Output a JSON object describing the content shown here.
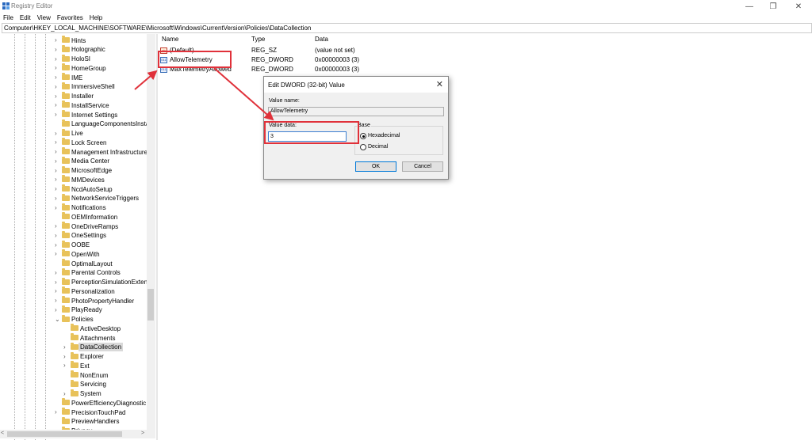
{
  "window": {
    "title": "Registry Editor",
    "controls": {
      "minimize": "—",
      "maximize": "❐",
      "close": "✕"
    }
  },
  "menu": [
    "File",
    "Edit",
    "View",
    "Favorites",
    "Help"
  ],
  "address": "Computer\\HKEY_LOCAL_MACHINE\\SOFTWARE\\Microsoft\\Windows\\CurrentVersion\\Policies\\DataCollection",
  "tree": [
    {
      "label": "Hints",
      "expander": ">",
      "level": 0
    },
    {
      "label": "Holographic",
      "expander": ">",
      "level": 0
    },
    {
      "label": "HoloSI",
      "expander": ">",
      "level": 0
    },
    {
      "label": "HomeGroup",
      "expander": ">",
      "level": 0
    },
    {
      "label": "IME",
      "expander": ">",
      "level": 0
    },
    {
      "label": "ImmersiveShell",
      "expander": ">",
      "level": 0
    },
    {
      "label": "Installer",
      "expander": ">",
      "level": 0
    },
    {
      "label": "InstallService",
      "expander": ">",
      "level": 0
    },
    {
      "label": "Internet Settings",
      "expander": ">",
      "level": 0
    },
    {
      "label": "LanguageComponentsInsta",
      "expander": "",
      "level": 0
    },
    {
      "label": "Live",
      "expander": ">",
      "level": 0
    },
    {
      "label": "Lock Screen",
      "expander": ">",
      "level": 0
    },
    {
      "label": "Management Infrastructure",
      "expander": ">",
      "level": 0
    },
    {
      "label": "Media Center",
      "expander": ">",
      "level": 0
    },
    {
      "label": "MicrosoftEdge",
      "expander": ">",
      "level": 0
    },
    {
      "label": "MMDevices",
      "expander": ">",
      "level": 0
    },
    {
      "label": "NcdAutoSetup",
      "expander": ">",
      "level": 0
    },
    {
      "label": "NetworkServiceTriggers",
      "expander": ">",
      "level": 0
    },
    {
      "label": "Notifications",
      "expander": ">",
      "level": 0
    },
    {
      "label": "OEMInformation",
      "expander": "",
      "level": 0
    },
    {
      "label": "OneDriveRamps",
      "expander": ">",
      "level": 0
    },
    {
      "label": "OneSettings",
      "expander": ">",
      "level": 0
    },
    {
      "label": "OOBE",
      "expander": ">",
      "level": 0
    },
    {
      "label": "OpenWith",
      "expander": ">",
      "level": 0
    },
    {
      "label": "OptimalLayout",
      "expander": "",
      "level": 0
    },
    {
      "label": "Parental Controls",
      "expander": ">",
      "level": 0
    },
    {
      "label": "PerceptionSimulationExten",
      "expander": ">",
      "level": 0
    },
    {
      "label": "Personalization",
      "expander": ">",
      "level": 0
    },
    {
      "label": "PhotoPropertyHandler",
      "expander": ">",
      "level": 0
    },
    {
      "label": "PlayReady",
      "expander": ">",
      "level": 0
    },
    {
      "label": "Policies",
      "expander": "v",
      "level": 0
    },
    {
      "label": "ActiveDesktop",
      "expander": "",
      "level": 1
    },
    {
      "label": "Attachments",
      "expander": "",
      "level": 1
    },
    {
      "label": "DataCollection",
      "expander": ">",
      "level": 1,
      "selected": true
    },
    {
      "label": "Explorer",
      "expander": ">",
      "level": 1
    },
    {
      "label": "Ext",
      "expander": ">",
      "level": 1
    },
    {
      "label": "NonEnum",
      "expander": "",
      "level": 1
    },
    {
      "label": "Servicing",
      "expander": "",
      "level": 1
    },
    {
      "label": "System",
      "expander": ">",
      "level": 1
    },
    {
      "label": "PowerEfficiencyDiagnostic",
      "expander": "",
      "level": 0
    },
    {
      "label": "PrecisionTouchPad",
      "expander": ">",
      "level": 0
    },
    {
      "label": "PreviewHandlers",
      "expander": "",
      "level": 0
    },
    {
      "label": "Privacy",
      "expander": "",
      "level": 0
    }
  ],
  "list": {
    "headers": {
      "name": "Name",
      "type": "Type",
      "data": "Data"
    },
    "rows": [
      {
        "name": "(Default)",
        "type": "REG_SZ",
        "data": "(value not set)",
        "icon": "ab"
      },
      {
        "name": "AllowTelemetry",
        "type": "REG_DWORD",
        "data": "0x00000003 (3)",
        "icon": "011"
      },
      {
        "name": "MaxTelemetryAllowed",
        "type": "REG_DWORD",
        "data": "0x00000003 (3)",
        "icon": "011"
      }
    ]
  },
  "dialog": {
    "title": "Edit DWORD (32-bit) Value",
    "close": "✕",
    "value_name_label": "Value name:",
    "value_name": "AllowTelemetry",
    "value_data_label": "Value data:",
    "value_data": "3",
    "base_label": "Base",
    "hex_label": "Hexadecimal",
    "dec_label": "Decimal",
    "base_selected": "Hexadecimal",
    "ok": "OK",
    "cancel": "Cancel"
  },
  "colors": {
    "highlight": "#e0313a",
    "selection": "#d9d9d9",
    "folder": "#e8c25a"
  }
}
